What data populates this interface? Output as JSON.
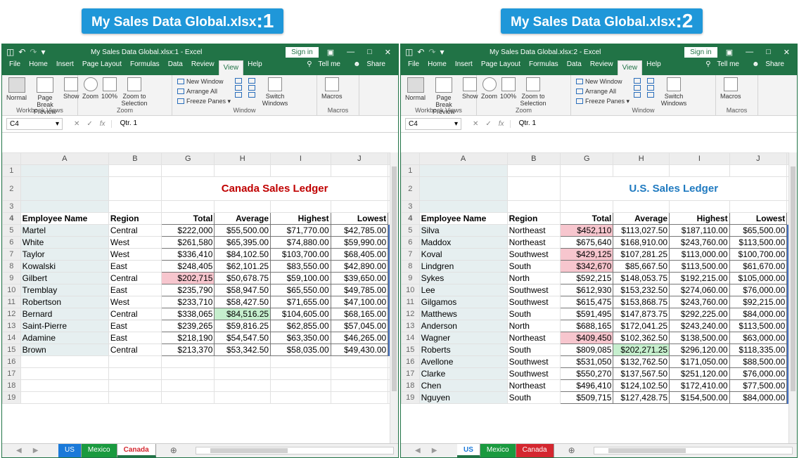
{
  "captions": {
    "left": {
      "text": "My Sales Data Global.xlsx",
      "num": ":1"
    },
    "right": {
      "text": "My Sales Data Global.xlsx",
      "num": ":2"
    }
  },
  "windows": [
    {
      "title": "My Sales Data Global.xlsx:1  -  Excel",
      "sign_in": "Sign in",
      "tabs": [
        "File",
        "Home",
        "Insert",
        "Page Layout",
        "Formulas",
        "Data",
        "Review",
        "View",
        "Help"
      ],
      "active_tab": "View",
      "tell_me": "Tell me",
      "share": "Share",
      "ribbon": {
        "normal": "Normal",
        "page_break": "Page Break Preview",
        "show": "Show",
        "zoom": "Zoom",
        "zoom_100": "100%",
        "zoom_sel": "Zoom to Selection",
        "new_window": "New Window",
        "arrange_all": "Arrange All",
        "freeze_panes": "Freeze Panes",
        "switch_windows": "Switch Windows",
        "macros": "Macros",
        "grp_workbook": "Workbook Views",
        "grp_zoom": "Zoom",
        "grp_window": "Window",
        "grp_macros": "Macros"
      },
      "name_box": "C4",
      "formula": "Qtr. 1",
      "columns": [
        "A",
        "B",
        "G",
        "H",
        "I",
        "J"
      ],
      "ledger_title": "Canada Sales Ledger",
      "ledger_color": "#c00000",
      "headers": [
        "Employee Name",
        "Region",
        "Total",
        "Average",
        "Highest",
        "Lowest"
      ],
      "rows": [
        {
          "n": "5",
          "name": "Martel",
          "region": "Central",
          "total": "$222,000",
          "avg": "$55,500.00",
          "high": "$71,770.00",
          "low": "$42,785.00"
        },
        {
          "n": "6",
          "name": "White",
          "region": "West",
          "total": "$261,580",
          "avg": "$65,395.00",
          "high": "$74,880.00",
          "low": "$59,990.00"
        },
        {
          "n": "7",
          "name": "Taylor",
          "region": "West",
          "total": "$336,410",
          "avg": "$84,102.50",
          "high": "$103,700.00",
          "low": "$68,405.00"
        },
        {
          "n": "8",
          "name": "Kowalski",
          "region": "East",
          "total": "$248,405",
          "avg": "$62,101.25",
          "high": "$83,550.00",
          "low": "$42,890.00"
        },
        {
          "n": "9",
          "name": "Gilbert",
          "region": "Central",
          "total": "$202,715",
          "avg": "$50,678.75",
          "high": "$59,100.00",
          "low": "$39,650.00",
          "total_hl": "red"
        },
        {
          "n": "10",
          "name": "Tremblay",
          "region": "East",
          "total": "$235,790",
          "avg": "$58,947.50",
          "high": "$65,550.00",
          "low": "$49,785.00"
        },
        {
          "n": "11",
          "name": "Robertson",
          "region": "West",
          "total": "$233,710",
          "avg": "$58,427.50",
          "high": "$71,655.00",
          "low": "$47,100.00"
        },
        {
          "n": "12",
          "name": "Bernard",
          "region": "Central",
          "total": "$338,065",
          "avg": "$84,516.25",
          "high": "$104,605.00",
          "low": "$68,165.00",
          "avg_hl": "green"
        },
        {
          "n": "13",
          "name": "Saint-Pierre",
          "region": "East",
          "total": "$239,265",
          "avg": "$59,816.25",
          "high": "$62,855.00",
          "low": "$57,045.00"
        },
        {
          "n": "14",
          "name": "Adamine",
          "region": "East",
          "total": "$218,190",
          "avg": "$54,547.50",
          "high": "$63,350.00",
          "low": "$46,265.00"
        },
        {
          "n": "15",
          "name": "Brown",
          "region": "Central",
          "total": "$213,370",
          "avg": "$53,342.50",
          "high": "$58,035.00",
          "low": "$49,430.00"
        }
      ],
      "empty_rows": [
        "16",
        "17",
        "18",
        "19"
      ],
      "sheets": [
        "US",
        "Mexico",
        "Canada"
      ],
      "active_sheet": "Canada"
    },
    {
      "title": "My Sales Data Global.xlsx:2  -  Excel",
      "sign_in": "Sign in",
      "tabs": [
        "File",
        "Home",
        "Insert",
        "Page Layout",
        "Formulas",
        "Data",
        "Review",
        "View",
        "Help"
      ],
      "active_tab": "View",
      "tell_me": "Tell me",
      "share": "Share",
      "ribbon": {
        "normal": "Normal",
        "page_break": "Page Break Preview",
        "show": "Show",
        "zoom": "Zoom",
        "zoom_100": "100%",
        "zoom_sel": "Zoom to Selection",
        "new_window": "New Window",
        "arrange_all": "Arrange All",
        "freeze_panes": "Freeze Panes",
        "switch_windows": "Switch Windows",
        "macros": "Macros",
        "grp_workbook": "Workbook Views",
        "grp_zoom": "Zoom",
        "grp_window": "Window",
        "grp_macros": "Macros"
      },
      "name_box": "C4",
      "formula": "Qtr. 1",
      "columns": [
        "A",
        "B",
        "G",
        "H",
        "I",
        "J"
      ],
      "ledger_title": "U.S. Sales Ledger",
      "ledger_color": "#1f7ac0",
      "headers": [
        "Employee Name",
        "Region",
        "Total",
        "Average",
        "Highest",
        "Lowest"
      ],
      "rows": [
        {
          "n": "5",
          "name": "Silva",
          "region": "Northeast",
          "total": "$452,110",
          "avg": "$113,027.50",
          "high": "$187,110.00",
          "low": "$65,500.00",
          "total_hl": "red"
        },
        {
          "n": "6",
          "name": "Maddox",
          "region": "Northeast",
          "total": "$675,640",
          "avg": "$168,910.00",
          "high": "$243,760.00",
          "low": "$113,500.00"
        },
        {
          "n": "7",
          "name": "Koval",
          "region": "Southwest",
          "total": "$429,125",
          "avg": "$107,281.25",
          "high": "$113,000.00",
          "low": "$100,700.00",
          "total_hl": "red"
        },
        {
          "n": "8",
          "name": "Lindgren",
          "region": "South",
          "total": "$342,670",
          "avg": "$85,667.50",
          "high": "$113,500.00",
          "low": "$61,670.00",
          "total_hl": "red"
        },
        {
          "n": "9",
          "name": "Sykes",
          "region": "North",
          "total": "$592,215",
          "avg": "$148,053.75",
          "high": "$192,215.00",
          "low": "$105,000.00"
        },
        {
          "n": "10",
          "name": "Lee",
          "region": "Southwest",
          "total": "$612,930",
          "avg": "$153,232.50",
          "high": "$274,060.00",
          "low": "$76,000.00"
        },
        {
          "n": "11",
          "name": "Gilgamos",
          "region": "Southwest",
          "total": "$615,475",
          "avg": "$153,868.75",
          "high": "$243,760.00",
          "low": "$92,215.00"
        },
        {
          "n": "12",
          "name": "Matthews",
          "region": "South",
          "total": "$591,495",
          "avg": "$147,873.75",
          "high": "$292,225.00",
          "low": "$84,000.00"
        },
        {
          "n": "13",
          "name": "Anderson",
          "region": "North",
          "total": "$688,165",
          "avg": "$172,041.25",
          "high": "$243,240.00",
          "low": "$113,500.00"
        },
        {
          "n": "14",
          "name": "Wagner",
          "region": "Northeast",
          "total": "$409,450",
          "avg": "$102,362.50",
          "high": "$138,500.00",
          "low": "$63,000.00",
          "total_hl": "red"
        },
        {
          "n": "15",
          "name": "Roberts",
          "region": "South",
          "total": "$809,085",
          "avg": "$202,271.25",
          "high": "$296,120.00",
          "low": "$118,335.00",
          "avg_hl": "green"
        },
        {
          "n": "16",
          "name": "Avellone",
          "region": "Southwest",
          "total": "$531,050",
          "avg": "$132,762.50",
          "high": "$171,050.00",
          "low": "$88,500.00"
        },
        {
          "n": "17",
          "name": "Clarke",
          "region": "Southwest",
          "total": "$550,270",
          "avg": "$137,567.50",
          "high": "$251,120.00",
          "low": "$76,000.00"
        },
        {
          "n": "18",
          "name": "Chen",
          "region": "Northeast",
          "total": "$496,410",
          "avg": "$124,102.50",
          "high": "$172,410.00",
          "low": "$77,500.00"
        },
        {
          "n": "19",
          "name": "Nguyen",
          "region": "South",
          "total": "$509,715",
          "avg": "$127,428.75",
          "high": "$154,500.00",
          "low": "$84,000.00"
        }
      ],
      "empty_rows": [],
      "sheets": [
        "US",
        "Mexico",
        "Canada"
      ],
      "active_sheet": "US"
    }
  ]
}
